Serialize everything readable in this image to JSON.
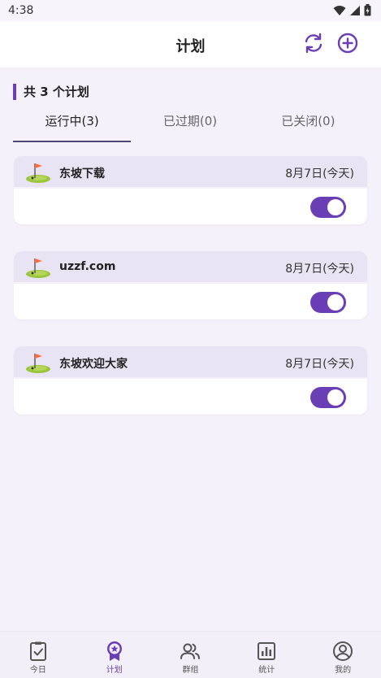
{
  "status_bar": {
    "time": "4:38"
  },
  "header": {
    "title": "计划",
    "refresh_icon": "refresh-icon",
    "add_icon": "plus-circle-icon"
  },
  "summary": {
    "text": "共 3 个计划"
  },
  "tabs": [
    {
      "label": "运行中(3)",
      "active": true
    },
    {
      "label": "已过期(0)",
      "active": false
    },
    {
      "label": "已关闭(0)",
      "active": false
    }
  ],
  "plans": [
    {
      "name": "东坡下载",
      "date": "8月7日(今天)",
      "enabled": true,
      "icon": "golf-flag-icon"
    },
    {
      "name": "uzzf.com",
      "date": "8月7日(今天)",
      "enabled": true,
      "icon": "golf-flag-icon"
    },
    {
      "name": "东坡欢迎大家",
      "date": "8月7日(今天)",
      "enabled": true,
      "icon": "golf-flag-icon"
    }
  ],
  "bottom_nav": [
    {
      "label": "今日",
      "icon": "clipboard-check-icon",
      "active": false
    },
    {
      "label": "计划",
      "icon": "badge-star-icon",
      "active": true
    },
    {
      "label": "群组",
      "icon": "users-icon",
      "active": false
    },
    {
      "label": "统计",
      "icon": "chart-icon",
      "active": false
    },
    {
      "label": "我的",
      "icon": "user-circle-icon",
      "active": false
    }
  ],
  "colors": {
    "accent": "#6a3fb5",
    "card_header": "#e9e4f3",
    "background": "#f4f1fa"
  }
}
